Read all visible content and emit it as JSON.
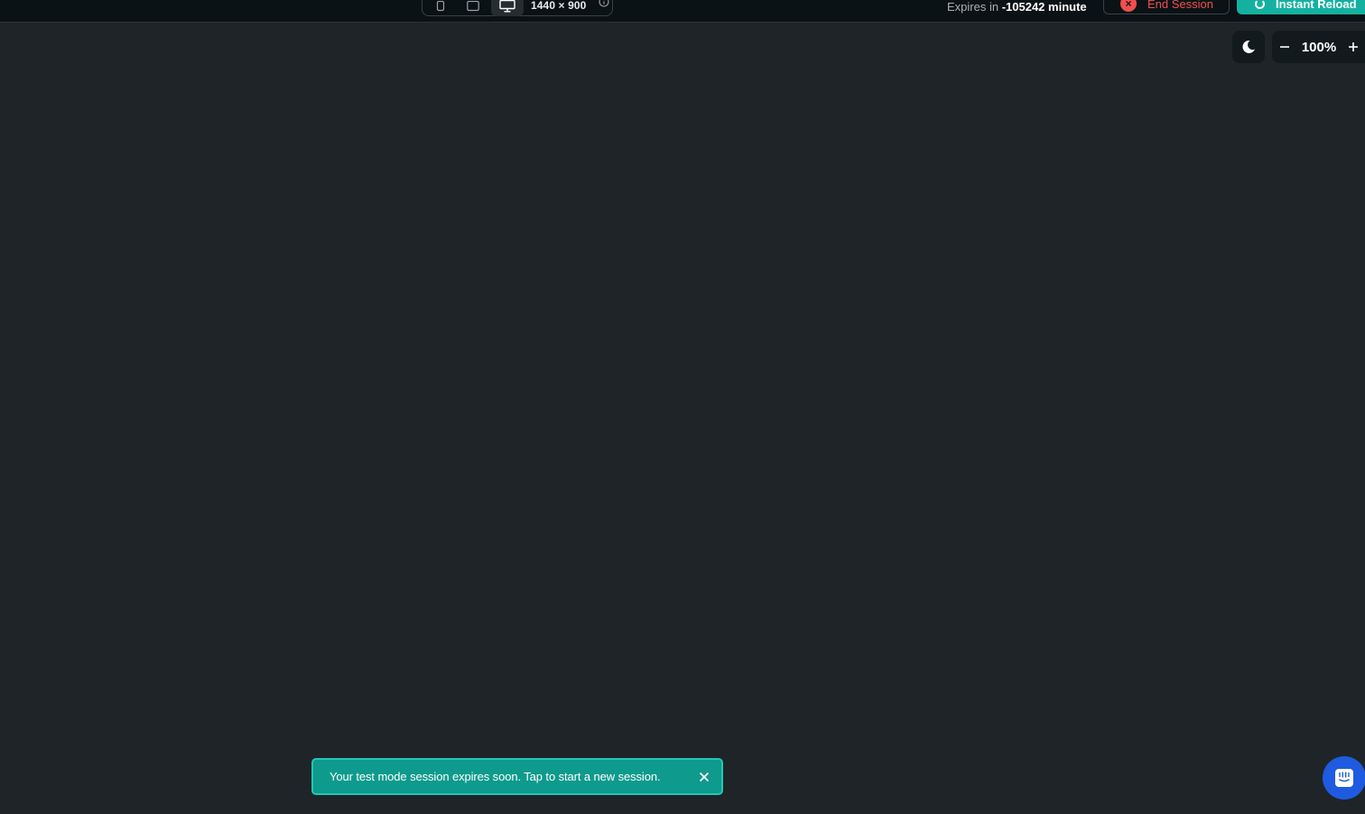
{
  "topbar": {
    "device_switcher": {
      "devices": [
        "mobile",
        "tablet",
        "desktop"
      ],
      "active_device": "desktop",
      "dimensions": "1440 × 900"
    },
    "expires": {
      "prefix": "Expires in",
      "value": "-105242 minute"
    },
    "end_session_label": "End Session",
    "instant_reload_label": "Instant Reload"
  },
  "viewer_controls": {
    "theme_icon": "moon-icon",
    "zoom_value": "100%",
    "zoom_out_icon": "minus-icon",
    "zoom_in_icon": "plus-icon"
  },
  "toast": {
    "message": "Your test mode session expires soon. Tap to start a new session.",
    "close_icon": "close-icon"
  },
  "chat_launcher": {
    "icon": "chat-icon"
  },
  "colors": {
    "background": "#1f2428",
    "topbar": "#0b1215",
    "accent": "#14b1a1",
    "toast": "#0e9a8d",
    "danger": "#ef4f4f",
    "chat": "#1e5be0"
  }
}
